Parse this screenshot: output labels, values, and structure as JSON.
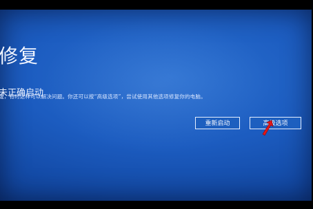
{
  "page": {
    "title": "修复",
    "subtitle": "未正确启动",
    "description": "或，有时这样可以解决问题。你还可以按“高级选项”，尝试使用其他选项修复你的电脑。"
  },
  "actions": {
    "restart_label": "重新启动",
    "advanced_label": "高级选项"
  },
  "colors": {
    "screen_blue": "#1c5cc0",
    "text": "#f2f6ff",
    "pointer": "#e01818"
  },
  "icons": {
    "pointer": "red-arrow-icon"
  }
}
